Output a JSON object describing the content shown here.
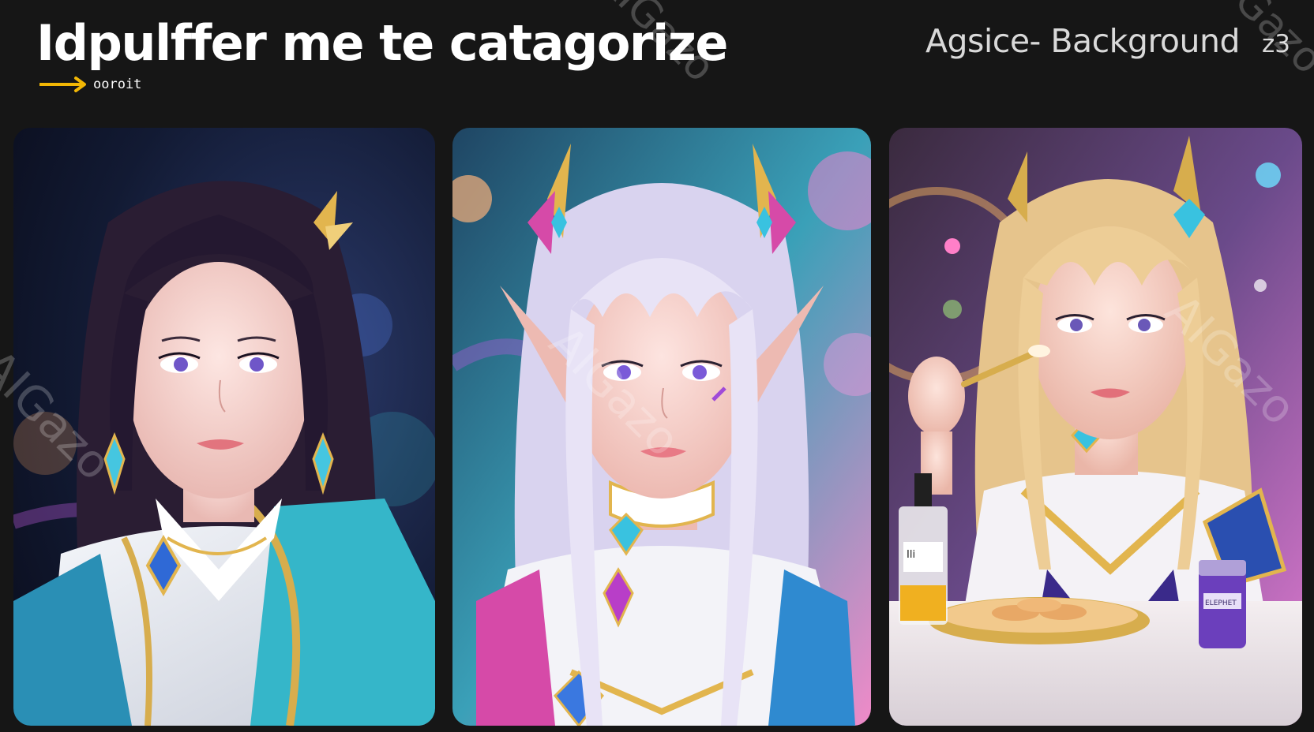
{
  "header": {
    "title": "Idpulffer me te catagorize",
    "sub_label": "ooroit",
    "background_label": "Agsice- Background",
    "badge": "z3"
  },
  "gallery": {
    "cards": [
      {
        "name": "portrait-dark-hair",
        "hair_color": "#2a1d33",
        "accent": "#35b6c9"
      },
      {
        "name": "portrait-silver-elf",
        "hair_color": "#d9d3ef",
        "accent": "#d64aa8"
      },
      {
        "name": "portrait-blonde-cosmetics",
        "hair_color": "#e6c48c",
        "accent": "#c69c3e",
        "bottle_label": "Ili",
        "jar_label": "ELEPHET"
      }
    ]
  },
  "watermark": "AIGazo",
  "colors": {
    "background": "#161616",
    "arrow": "#f2b705",
    "text": "#ffffff"
  }
}
